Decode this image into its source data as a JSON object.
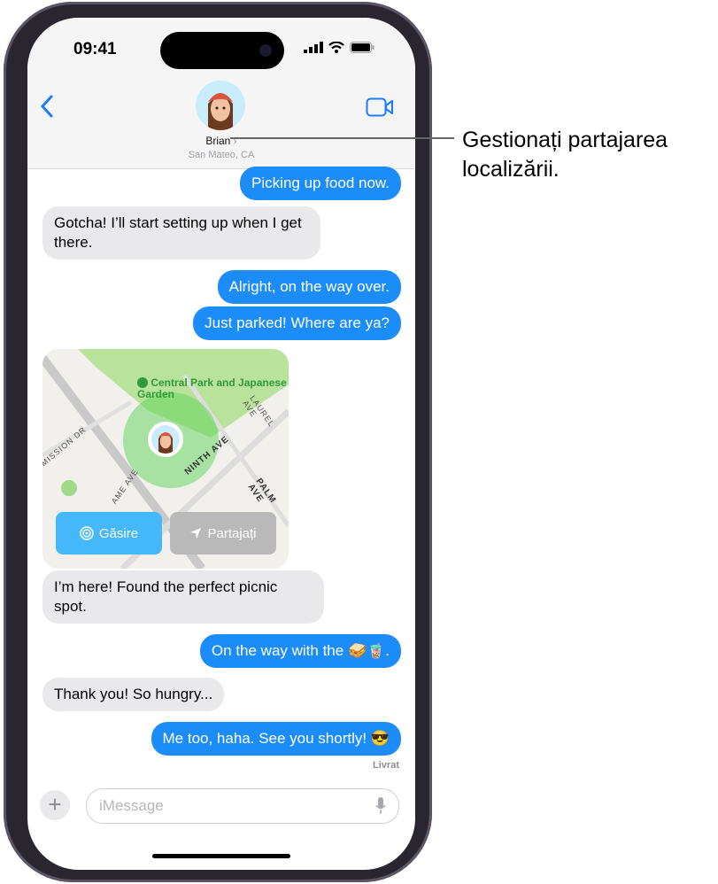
{
  "status_bar": {
    "time": "09:41"
  },
  "header": {
    "contact_name": "Brian",
    "location": "San Mateo, CA",
    "back_icon": "chevron-left-icon",
    "video_icon": "video-camera-icon"
  },
  "messages": [
    {
      "dir": "out",
      "text": "Picking up food now."
    },
    {
      "dir": "in",
      "text": "Gotcha! I’ll start setting up when I get there."
    },
    {
      "dir": "out",
      "text": "Alright, on the way over."
    },
    {
      "dir": "out",
      "text": "Just parked! Where are ya?"
    },
    {
      "dir": "in",
      "text": "I’m here! Found the perfect picnic spot."
    },
    {
      "dir": "out",
      "text": "On the way with the 🥪🧋."
    },
    {
      "dir": "in",
      "text": "Thank you! So hungry..."
    },
    {
      "dir": "out",
      "text": "Me too, haha. See you shortly! 😎"
    }
  ],
  "map": {
    "poi": "Central Park and Japanese Garden",
    "streets": [
      "NINTH AVE",
      "LAUREL AVE",
      "PALM AVE",
      "MISSION DR",
      "AME AVE"
    ],
    "find_button": "Găsire",
    "share_button": "Partajați"
  },
  "delivered": "Livrat",
  "composer": {
    "placeholder": "iMessage"
  },
  "callout": {
    "line1": "Gestionați partajarea",
    "line2": "localizării."
  },
  "colors": {
    "bubble_out": "#1b8cf8",
    "bubble_in": "#e9e9eb",
    "accent": "#1a7cf6",
    "find": "#45b8fb"
  }
}
